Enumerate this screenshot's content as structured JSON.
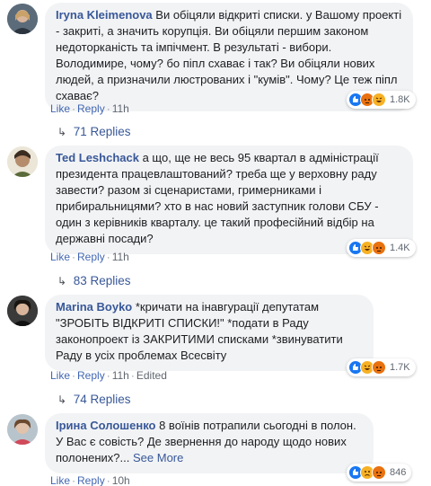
{
  "comments": [
    {
      "author": "Iryna Kleimenova",
      "text": "Ви обіцяли відкриті списки. у Вашому проекті - закриті, а значить корупція. Ви обіцяли першим законом недоторканість та імпічмент. В результаті - вибори. Володимире, чому? бо піпл схаває і так? Ви обіцяли нових людей, а призначили люстрованих і \"кумів\". Чому? Це теж піпл схаває?",
      "like": "Like",
      "reply": "Reply",
      "time": "11h",
      "edited": "",
      "reactions_count": "1.8K",
      "replies": "71 Replies"
    },
    {
      "author": "Ted Leshchack",
      "text": "а що, ще не весь 95 квартал в адміністрації президента працевлаштований? треба ще у верховну раду завести? разом зі сценаристами, гримерниками і прибиральницями? хто в нас новий заступник голови СБУ - один з керівників кварталу. це такий професійний відбір на державні посади?",
      "like": "Like",
      "reply": "Reply",
      "time": "11h",
      "edited": "",
      "reactions_count": "1.4K",
      "replies": "83 Replies"
    },
    {
      "author": "Marina Boyko",
      "text": "*кричати на інавгурації депутатам \"ЗРОБІТЬ ВІДКРИТІ СПИСКИ!\" *подати в Раду законопроект із ЗАКРИТИМИ списками *звинуватити Раду в усіх проблемах Всесвіту",
      "like": "Like",
      "reply": "Reply",
      "time": "11h",
      "edited": "Edited",
      "reactions_count": "1.7K",
      "replies": "74 Replies"
    },
    {
      "author": "Ірина Солошенко",
      "text": "8 воїнів потрапили сьогодні в полон. У Вас є совість? Де звернення до народу щодо нових полонених?...",
      "see_more": "See More",
      "like": "Like",
      "reply": "Reply",
      "time": "10h",
      "edited": "",
      "reactions_count": "846",
      "replies": ""
    }
  ],
  "colors": {
    "link": "#385898",
    "bubble": "#f2f3f5",
    "like_icon": "#1877f2",
    "angry_icon": "#e9710f",
    "haha_icon": "#f7b125"
  }
}
